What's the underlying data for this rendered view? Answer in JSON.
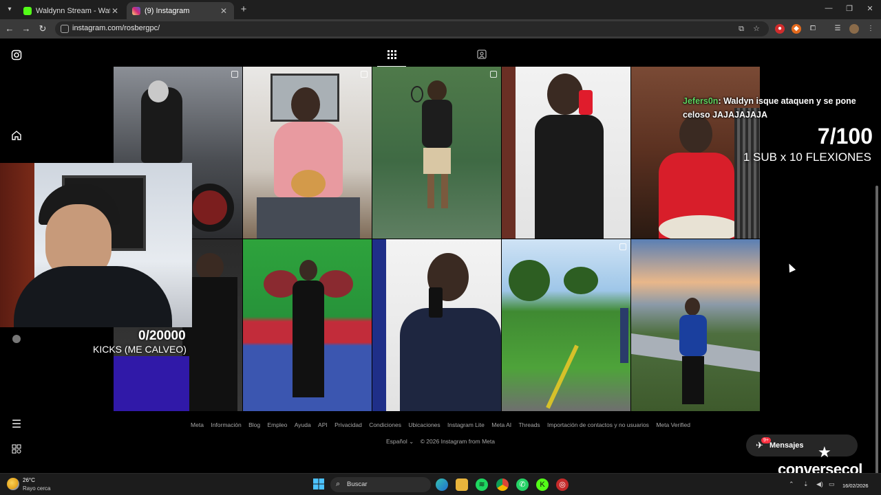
{
  "browser": {
    "tabs": [
      {
        "title": "Waldynn Stream - Watch Live o",
        "favicon_color": "#53fc18"
      },
      {
        "title": "(9) Instagram",
        "favicon_color": "#d62976"
      }
    ],
    "url": "instagram.com/rosbergpc/"
  },
  "instagram": {
    "footer_links": [
      "Meta",
      "Información",
      "Blog",
      "Empleo",
      "Ayuda",
      "API",
      "Privacidad",
      "Condiciones",
      "Ubicaciones",
      "Instagram Lite",
      "Meta AI",
      "Threads",
      "Importación de contactos y no usuarios",
      "Meta Verified"
    ],
    "language": "Español",
    "copyright": "© 2026 Instagram from Meta",
    "messages_label": "Mensajes",
    "messages_badge": "9+"
  },
  "overlay": {
    "chat_user": "Jefers0n",
    "chat_message": ": Waldyn isque ataquen y se pone celoso JAJAJAJAJA",
    "goal_count": "7/100",
    "goal_label": "1 SUB x 10 FLEXIONES",
    "kicks_count": "0/20000",
    "kicks_label": "KICKS (ME CALVEO)",
    "brand": "conversecol"
  },
  "taskbar": {
    "weather_temp": "26°C",
    "weather_desc": "Rayo cerca",
    "search_placeholder": "Buscar",
    "date": "16/02/2026"
  }
}
